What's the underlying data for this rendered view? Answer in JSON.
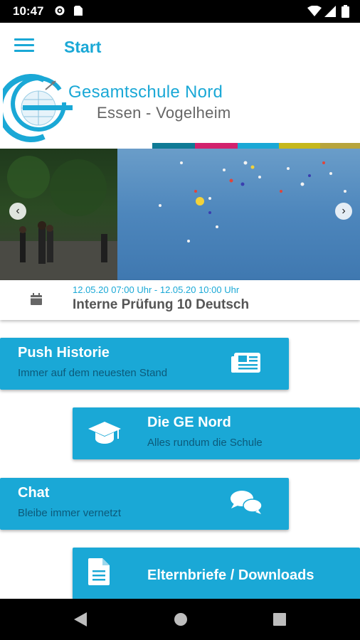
{
  "status_bar": {
    "time": "10:47"
  },
  "app_bar": {
    "title": "Start"
  },
  "logo": {
    "name": "Gesamtschule Nord",
    "location": "Essen - Vogelheim"
  },
  "event": {
    "date": "12.05.20 07:00 Uhr - 12.05.20 10:00 Uhr",
    "title": "Interne Prüfung 10 Deutsch"
  },
  "tiles": [
    {
      "title": "Push Historie",
      "subtitle": "Immer auf dem neuesten Stand",
      "icon": "newspaper-icon"
    },
    {
      "title": "Die GE Nord",
      "subtitle": "Alles rundum die Schule",
      "icon": "graduation-cap-icon"
    },
    {
      "title": "Chat",
      "subtitle": "Bleibe immer vernetzt",
      "icon": "chat-bubbles-icon"
    },
    {
      "title": "Elternbriefe / Downloads",
      "subtitle": "",
      "icon": "document-icon"
    }
  ],
  "colors": {
    "accent": "#1aa8d6",
    "stripe": [
      "#0f7a95",
      "#d2226d",
      "#1aa8d6",
      "#c6b81c",
      "#b7a43c"
    ]
  }
}
